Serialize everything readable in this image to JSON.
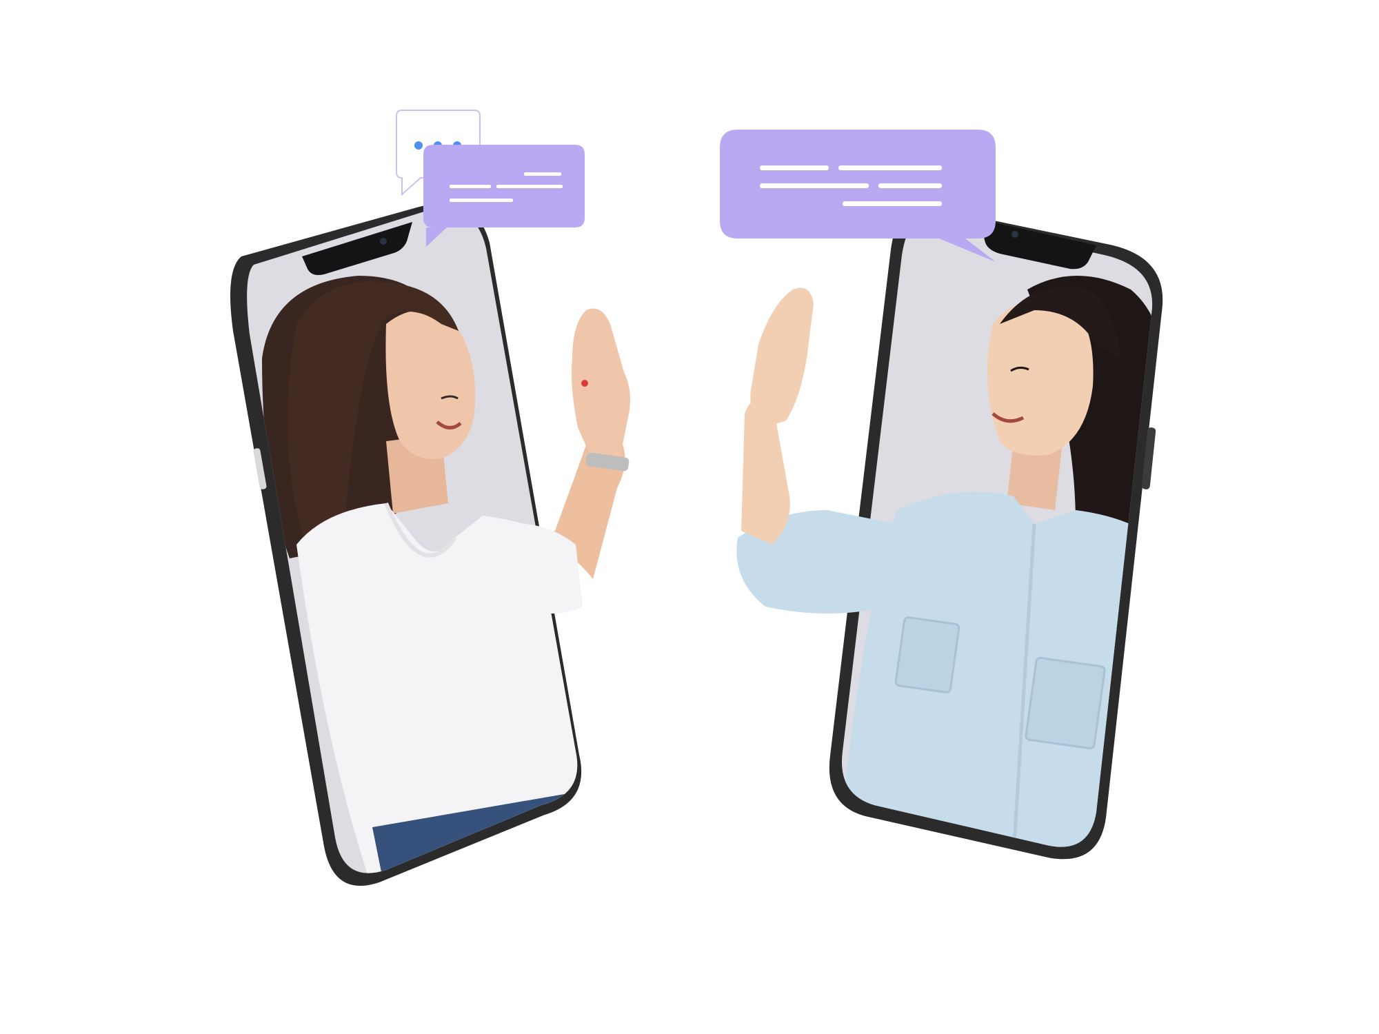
{
  "colors": {
    "background": "#ffffff",
    "phone_frame": "#2b2b2b",
    "phone_bezel": "#141414",
    "screen_backdrop": "#dcdce2",
    "bubble_purple": "#b9a8f2",
    "bubble_outline": "#c9c2ef",
    "typing_dots": "#4f8ff0",
    "bubble_lines": "#ffffff",
    "skin_left": "#f0c6aa",
    "skin_right": "#f2cfb3",
    "hair_left": "#3a2620",
    "hair_right": "#1f1716",
    "shirt_left": "#f4f4f6",
    "shirt_right": "#c7dcea",
    "jeans": "#36527c"
  },
  "icons": {
    "typing_bubble": "typing-dots-bubble-icon",
    "message_bubble_small": "chat-message-bubble-icon",
    "message_bubble_large": "chat-message-bubble-icon",
    "watch": "wristwatch-icon"
  },
  "scene": {
    "left_person": "woman-white-tshirt",
    "right_person": "woman-denim-shirt",
    "gesture": "high-five"
  }
}
